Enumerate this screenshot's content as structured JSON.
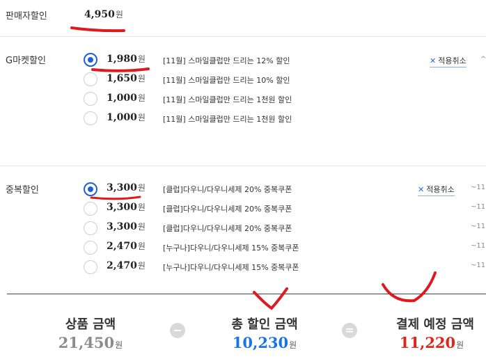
{
  "seller_discount": {
    "label": "판매자할인",
    "amount": "4,950",
    "unit": "원"
  },
  "gmarket_discount": {
    "label": "G마켓할인",
    "options": [
      {
        "amount": "1,980",
        "unit": "원",
        "desc": "[11월] 스마일클럽만 드리는 12% 할인",
        "selected": true
      },
      {
        "amount": "1,650",
        "unit": "원",
        "desc": "[11월] 스마일클럽만 드리는 10% 할인",
        "selected": false
      },
      {
        "amount": "1,000",
        "unit": "원",
        "desc": "[11월] 스마일클럽만 드리는 1천원 할인",
        "selected": false
      },
      {
        "amount": "1,000",
        "unit": "원",
        "desc": "[11월] 스마일클럽만 드리는 1천원 할인",
        "selected": false
      }
    ],
    "cancel_label": "적용취소",
    "edge": "^"
  },
  "duplicate_discount": {
    "label": "중복할인",
    "options": [
      {
        "amount": "3,300",
        "unit": "원",
        "desc": "[클럽]다우니/다우니세제 20% 중복쿠폰",
        "selected": true
      },
      {
        "amount": "3,300",
        "unit": "원",
        "desc": "[클럽]다우니/다우니세제 20% 중복쿠폰",
        "selected": false
      },
      {
        "amount": "3,300",
        "unit": "원",
        "desc": "[클럽]다우니/다우니세제 20% 중복쿠폰",
        "selected": false
      },
      {
        "amount": "2,470",
        "unit": "원",
        "desc": "[누구나]다우니/다우니세제 15% 중복쿠폰",
        "selected": false
      },
      {
        "amount": "2,470",
        "unit": "원",
        "desc": "[누구나]다우니/다우니세제 15% 중복쿠폰",
        "selected": false
      }
    ],
    "cancel_label": "적용취소",
    "edge": "~11"
  },
  "summary": {
    "product_label": "상품 금액",
    "product_amount": "21,450",
    "product_unit": "원",
    "minus": "−",
    "discount_label": "총 할인 금액",
    "discount_amount": "10,230",
    "discount_unit": "원",
    "equals": "=",
    "payment_label": "결제 예정 금액",
    "payment_amount": "11,220",
    "payment_unit": "원"
  },
  "colors": {
    "accent": "#1e5fd6",
    "total_discount": "#1a73e8",
    "payment": "#e0251b",
    "product": "#8c8c8c",
    "annotation": "#e0191f"
  },
  "icons": {
    "selected_radio": "radio-selected-icon",
    "cancel": "close-icon"
  }
}
